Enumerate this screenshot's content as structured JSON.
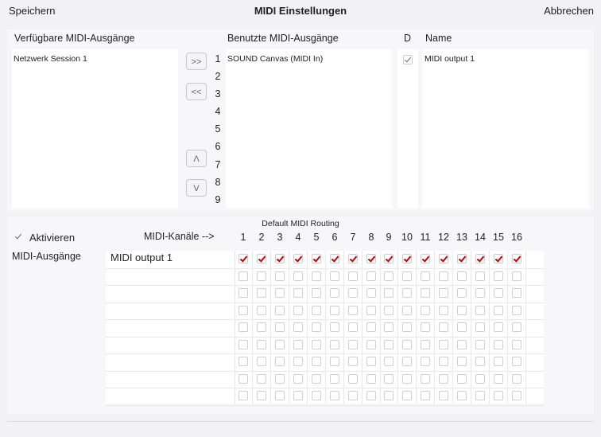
{
  "topbar": {
    "save": "Speichern",
    "title": "MIDI Einstellungen",
    "cancel": "Abbrechen"
  },
  "outputs": {
    "available_header": "Verfügbare MIDI-Ausgänge",
    "used_header": "Benutzte MIDI-Ausgänge",
    "d_header": "D",
    "name_header": "Name",
    "available": [
      "Netzwerk Session 1"
    ],
    "used": [
      "SOUND Canvas (MIDI In)"
    ],
    "slot_numbers": [
      "1",
      "2",
      "3",
      "4",
      "5",
      "6",
      "7",
      "8",
      "9"
    ],
    "d_checked": true,
    "names": [
      "MIDI output 1"
    ],
    "buttons": {
      "add": ">>",
      "remove": "<<",
      "up": "Λ",
      "down": "V"
    }
  },
  "routing": {
    "title": "Default MIDI Routing",
    "activate_label": "Aktivieren",
    "activate_checked": true,
    "channels_label": "MIDI-Kanäle  -->",
    "outputs_label": "MIDI-Ausgänge",
    "channels": [
      "1",
      "2",
      "3",
      "4",
      "5",
      "6",
      "7",
      "8",
      "9",
      "10",
      "11",
      "12",
      "13",
      "14",
      "15",
      "16"
    ],
    "rows": [
      {
        "name": "MIDI output 1",
        "checked": [
          true,
          true,
          true,
          true,
          true,
          true,
          true,
          true,
          true,
          true,
          true,
          true,
          true,
          true,
          true,
          true
        ]
      },
      {
        "name": "",
        "checked": []
      },
      {
        "name": "",
        "checked": []
      },
      {
        "name": "",
        "checked": []
      },
      {
        "name": "",
        "checked": []
      },
      {
        "name": "",
        "checked": []
      },
      {
        "name": "",
        "checked": []
      },
      {
        "name": "",
        "checked": []
      },
      {
        "name": "",
        "checked": []
      }
    ]
  }
}
